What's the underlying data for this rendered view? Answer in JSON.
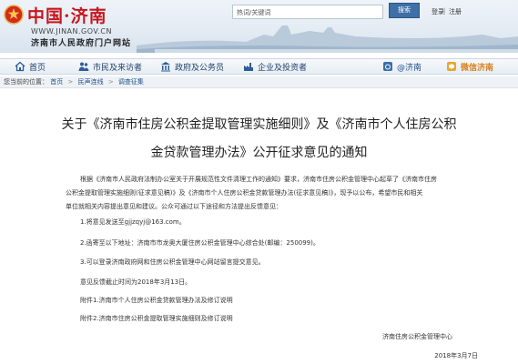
{
  "header": {
    "site_name": "中国·济南",
    "site_url": "WWW.JINAN.GOV.CN",
    "site_subtitle": "济南市人民政府门户网站",
    "search": {
      "placeholder": "热词/关键词"
    },
    "search_button": "搜索",
    "links": [
      "登录",
      "注册"
    ]
  },
  "nav": {
    "items": [
      {
        "label": "首页",
        "icon": "home-icon"
      },
      {
        "label": "市民及来访者",
        "icon": "people-icon"
      },
      {
        "label": "政府及公务员",
        "icon": "building-icon"
      },
      {
        "label": "企业及投资者",
        "icon": "factory-icon"
      }
    ],
    "right_links": [
      "@济南",
      "微信济南"
    ]
  },
  "breadcrumb": {
    "prefix": "您当前的位置：",
    "items": [
      "首页",
      "民声连线",
      "调查征集"
    ]
  },
  "article": {
    "title_line1": "关于《济南市住房公积金提取管理实施细则》及《济南市个人住房公积",
    "title_line2": "金贷款管理办法》公开征求意见的通知",
    "body_lines": [
      "根据《济南市人民政府法制办公室关于开展规范性文件清理工作的通知》要求，济南市住房公积金管理中心起草了《济南市住房",
      "公积金提取管理实施细则(征求意见稿)》及《济南市个人住房公积金贷款管理办法(征求意见稿)》，现予以公布，希望市民和相关",
      "单位就相关内容提出意见和建议。公众可通过以下途径和方法提出反馈意见："
    ],
    "items": [
      "1.将意见发送至gjjzqyj@163.com。",
      "2.函寄至以下地址：济南市市龙奥大厦住房公积金管理中心综合处(邮编：250099)。",
      "3.可以登录济南政府网和住房公积金管理中心网站留言提交意见。",
      "意见反馈截止时间为2018年3月13日。",
      "附件1.济南市个人住房公积金贷款管理办法及修订说明",
      "附件2.济南市住房公积金提取管理实施细则及修订说明"
    ],
    "signature": "济南住房公积金管理中心",
    "date": "2018年3月7日"
  },
  "colors": {
    "brand_red": "#c8161d",
    "nav_blue": "#1f3f6a",
    "link_blue": "#1f4f8a"
  }
}
